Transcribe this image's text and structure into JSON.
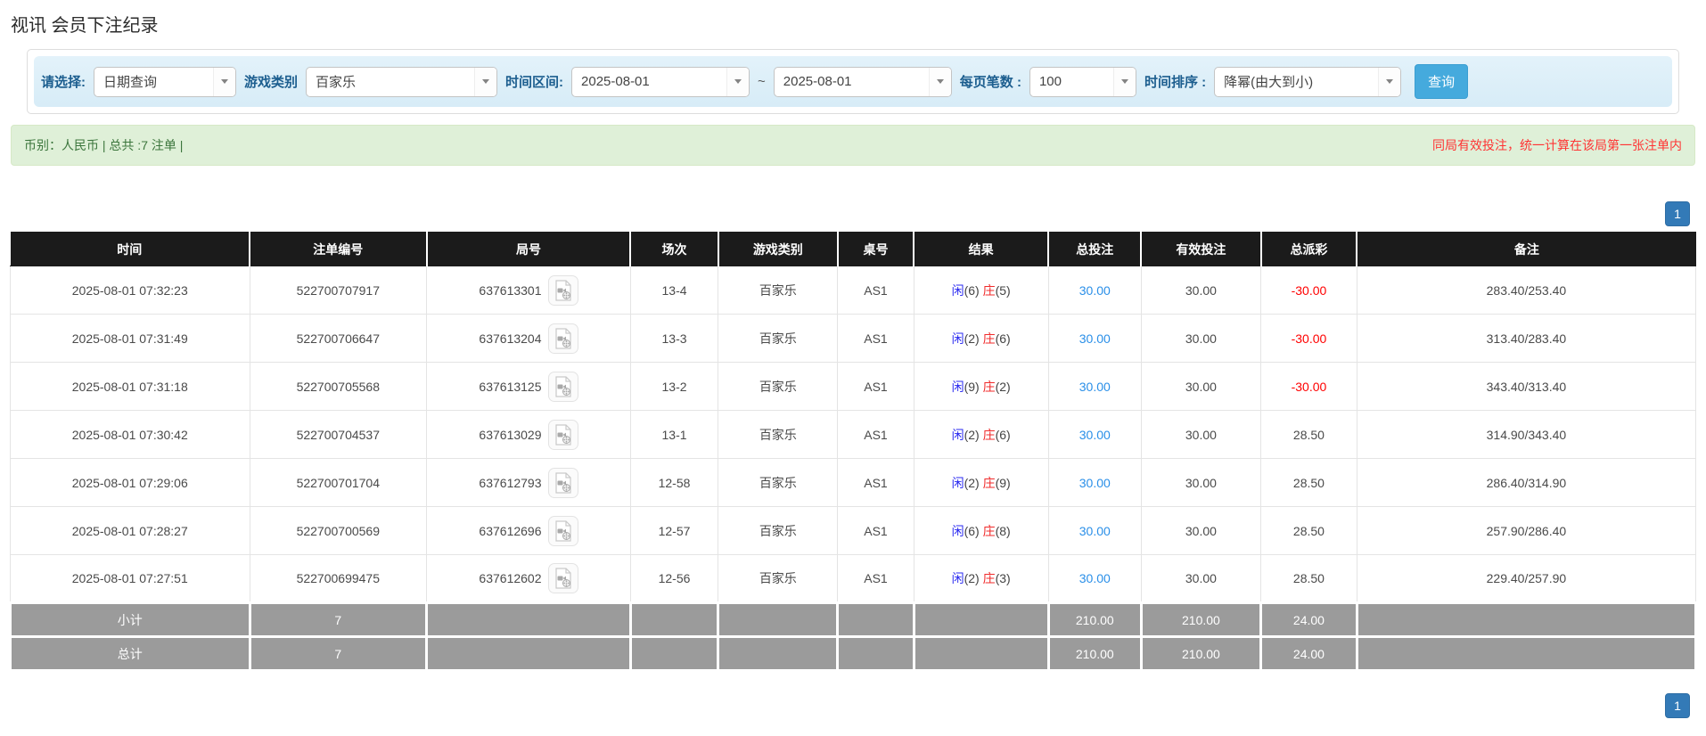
{
  "page": {
    "title": "视讯 会员下注纪录"
  },
  "filters": {
    "select_label": "请选择:",
    "select_value": "日期查询",
    "game_type_label": "游戏类别",
    "game_type_value": "百家乐",
    "time_range_label": "时间区间:",
    "time_from": "2025-08-01",
    "range_separator": "~",
    "time_to": "2025-08-01",
    "page_size_label": "每页笔数 :",
    "page_size_value": "100",
    "sort_label": "时间排序 :",
    "sort_value": "降幂(由大到小)",
    "search_button": "查询"
  },
  "summary": {
    "left_text": "币别：人民币 | 总共 :7 注单 |",
    "right_note": "同局有效投注，统一计算在该局第一张注单内"
  },
  "pagination": {
    "page": "1"
  },
  "icons": {
    "combo_arrow": "chevron-down-icon",
    "round_video": "video-replay-icon"
  },
  "colors": {
    "header_bg": "#1b1b1b",
    "footer_bg": "#9b9b9b",
    "filter_bar_bg": "#d9edf7",
    "summary_bg": "#dff0d8",
    "summary_text": "#3c763d",
    "warning_text": "#ff3333",
    "search_button": "#45aadd",
    "pagination_active": "#337ab7",
    "player_blue": "#2b2bf0",
    "banker_red": "#f02b2b",
    "bet_link_blue": "#2a8fe8",
    "negative_red": "#ff0000"
  },
  "table": {
    "headers": [
      "时间",
      "注单编号",
      "局号",
      "场次",
      "游戏类别",
      "桌号",
      "结果",
      "总投注",
      "有效投注",
      "总派彩",
      "备注"
    ],
    "col_widths": [
      "14.2%",
      "10.5%",
      "12.1%",
      "5.2%",
      "7.1%",
      "4.5%",
      "8.0%",
      "5.5%",
      "7.1%",
      "5.7%",
      "20.1%"
    ],
    "rows": [
      {
        "time": "2025-08-01 07:32:23",
        "bet_id": "522700707917",
        "round_id": "637613301",
        "session": "13-4",
        "game": "百家乐",
        "table_no": "AS1",
        "result": {
          "player": "闲",
          "player_score": "(6)",
          "banker": "庄",
          "banker_score": "(5)"
        },
        "total_bet": "30.00",
        "valid_bet": "30.00",
        "payout": "-30.00",
        "payout_negative": true,
        "remark": "283.40/253.40"
      },
      {
        "time": "2025-08-01 07:31:49",
        "bet_id": "522700706647",
        "round_id": "637613204",
        "session": "13-3",
        "game": "百家乐",
        "table_no": "AS1",
        "result": {
          "player": "闲",
          "player_score": "(2)",
          "banker": "庄",
          "banker_score": "(6)"
        },
        "total_bet": "30.00",
        "valid_bet": "30.00",
        "payout": "-30.00",
        "payout_negative": true,
        "remark": "313.40/283.40"
      },
      {
        "time": "2025-08-01 07:31:18",
        "bet_id": "522700705568",
        "round_id": "637613125",
        "session": "13-2",
        "game": "百家乐",
        "table_no": "AS1",
        "result": {
          "player": "闲",
          "player_score": "(9)",
          "banker": "庄",
          "banker_score": "(2)"
        },
        "total_bet": "30.00",
        "valid_bet": "30.00",
        "payout": "-30.00",
        "payout_negative": true,
        "remark": "343.40/313.40"
      },
      {
        "time": "2025-08-01 07:30:42",
        "bet_id": "522700704537",
        "round_id": "637613029",
        "session": "13-1",
        "game": "百家乐",
        "table_no": "AS1",
        "result": {
          "player": "闲",
          "player_score": "(2)",
          "banker": "庄",
          "banker_score": "(6)"
        },
        "total_bet": "30.00",
        "valid_bet": "30.00",
        "payout": "28.50",
        "payout_negative": false,
        "remark": "314.90/343.40"
      },
      {
        "time": "2025-08-01 07:29:06",
        "bet_id": "522700701704",
        "round_id": "637612793",
        "session": "12-58",
        "game": "百家乐",
        "table_no": "AS1",
        "result": {
          "player": "闲",
          "player_score": "(2)",
          "banker": "庄",
          "banker_score": "(9)"
        },
        "total_bet": "30.00",
        "valid_bet": "30.00",
        "payout": "28.50",
        "payout_negative": false,
        "remark": "286.40/314.90"
      },
      {
        "time": "2025-08-01 07:28:27",
        "bet_id": "522700700569",
        "round_id": "637612696",
        "session": "12-57",
        "game": "百家乐",
        "table_no": "AS1",
        "result": {
          "player": "闲",
          "player_score": "(6)",
          "banker": "庄",
          "banker_score": "(8)"
        },
        "total_bet": "30.00",
        "valid_bet": "30.00",
        "payout": "28.50",
        "payout_negative": false,
        "remark": "257.90/286.40"
      },
      {
        "time": "2025-08-01 07:27:51",
        "bet_id": "522700699475",
        "round_id": "637612602",
        "session": "12-56",
        "game": "百家乐",
        "table_no": "AS1",
        "result": {
          "player": "闲",
          "player_score": "(2)",
          "banker": "庄",
          "banker_score": "(3)"
        },
        "total_bet": "30.00",
        "valid_bet": "30.00",
        "payout": "28.50",
        "payout_negative": false,
        "remark": "229.40/257.90"
      }
    ],
    "subtotal": {
      "label": "小计",
      "count": "7",
      "total_bet": "210.00",
      "valid_bet": "210.00",
      "payout": "24.00"
    },
    "total": {
      "label": "总计",
      "count": "7",
      "total_bet": "210.00",
      "valid_bet": "210.00",
      "payout": "24.00"
    }
  }
}
